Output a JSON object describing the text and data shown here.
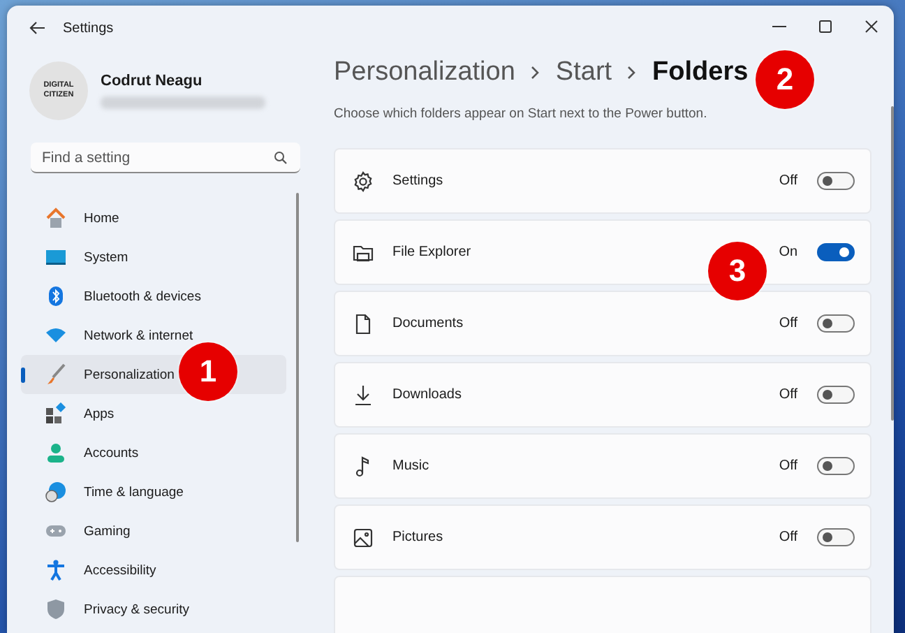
{
  "window": {
    "title": "Settings"
  },
  "profile": {
    "name": "Codrut Neagu",
    "avatar_text": [
      "DIGITAL",
      "CITIZEN"
    ]
  },
  "search": {
    "placeholder": "Find a setting"
  },
  "nav": [
    {
      "label": "Home",
      "kind": "home",
      "selected": false
    },
    {
      "label": "System",
      "kind": "system",
      "selected": false
    },
    {
      "label": "Bluetooth & devices",
      "kind": "bluetooth",
      "selected": false
    },
    {
      "label": "Network & internet",
      "kind": "wifi",
      "selected": false
    },
    {
      "label": "Personalization",
      "kind": "brush",
      "selected": true
    },
    {
      "label": "Apps",
      "kind": "apps",
      "selected": false
    },
    {
      "label": "Accounts",
      "kind": "person",
      "selected": false
    },
    {
      "label": "Time & language",
      "kind": "globe",
      "selected": false
    },
    {
      "label": "Gaming",
      "kind": "gamepad",
      "selected": false
    },
    {
      "label": "Accessibility",
      "kind": "accessibility",
      "selected": false
    },
    {
      "label": "Privacy & security",
      "kind": "shield",
      "selected": false
    }
  ],
  "breadcrumb": [
    "Personalization",
    "Start",
    "Folders"
  ],
  "description": "Choose which folders appear on Start next to the Power button.",
  "folders": [
    {
      "label": "Settings",
      "kind": "gear",
      "on": false,
      "state_text": "Off"
    },
    {
      "label": "File Explorer",
      "kind": "folder",
      "on": true,
      "state_text": "On"
    },
    {
      "label": "Documents",
      "kind": "document",
      "on": false,
      "state_text": "Off"
    },
    {
      "label": "Downloads",
      "kind": "download",
      "on": false,
      "state_text": "Off"
    },
    {
      "label": "Music",
      "kind": "music",
      "on": false,
      "state_text": "Off"
    },
    {
      "label": "Pictures",
      "kind": "picture",
      "on": false,
      "state_text": "Off"
    }
  ],
  "callouts": [
    {
      "text": "1"
    },
    {
      "text": "2"
    },
    {
      "text": "3"
    }
  ]
}
